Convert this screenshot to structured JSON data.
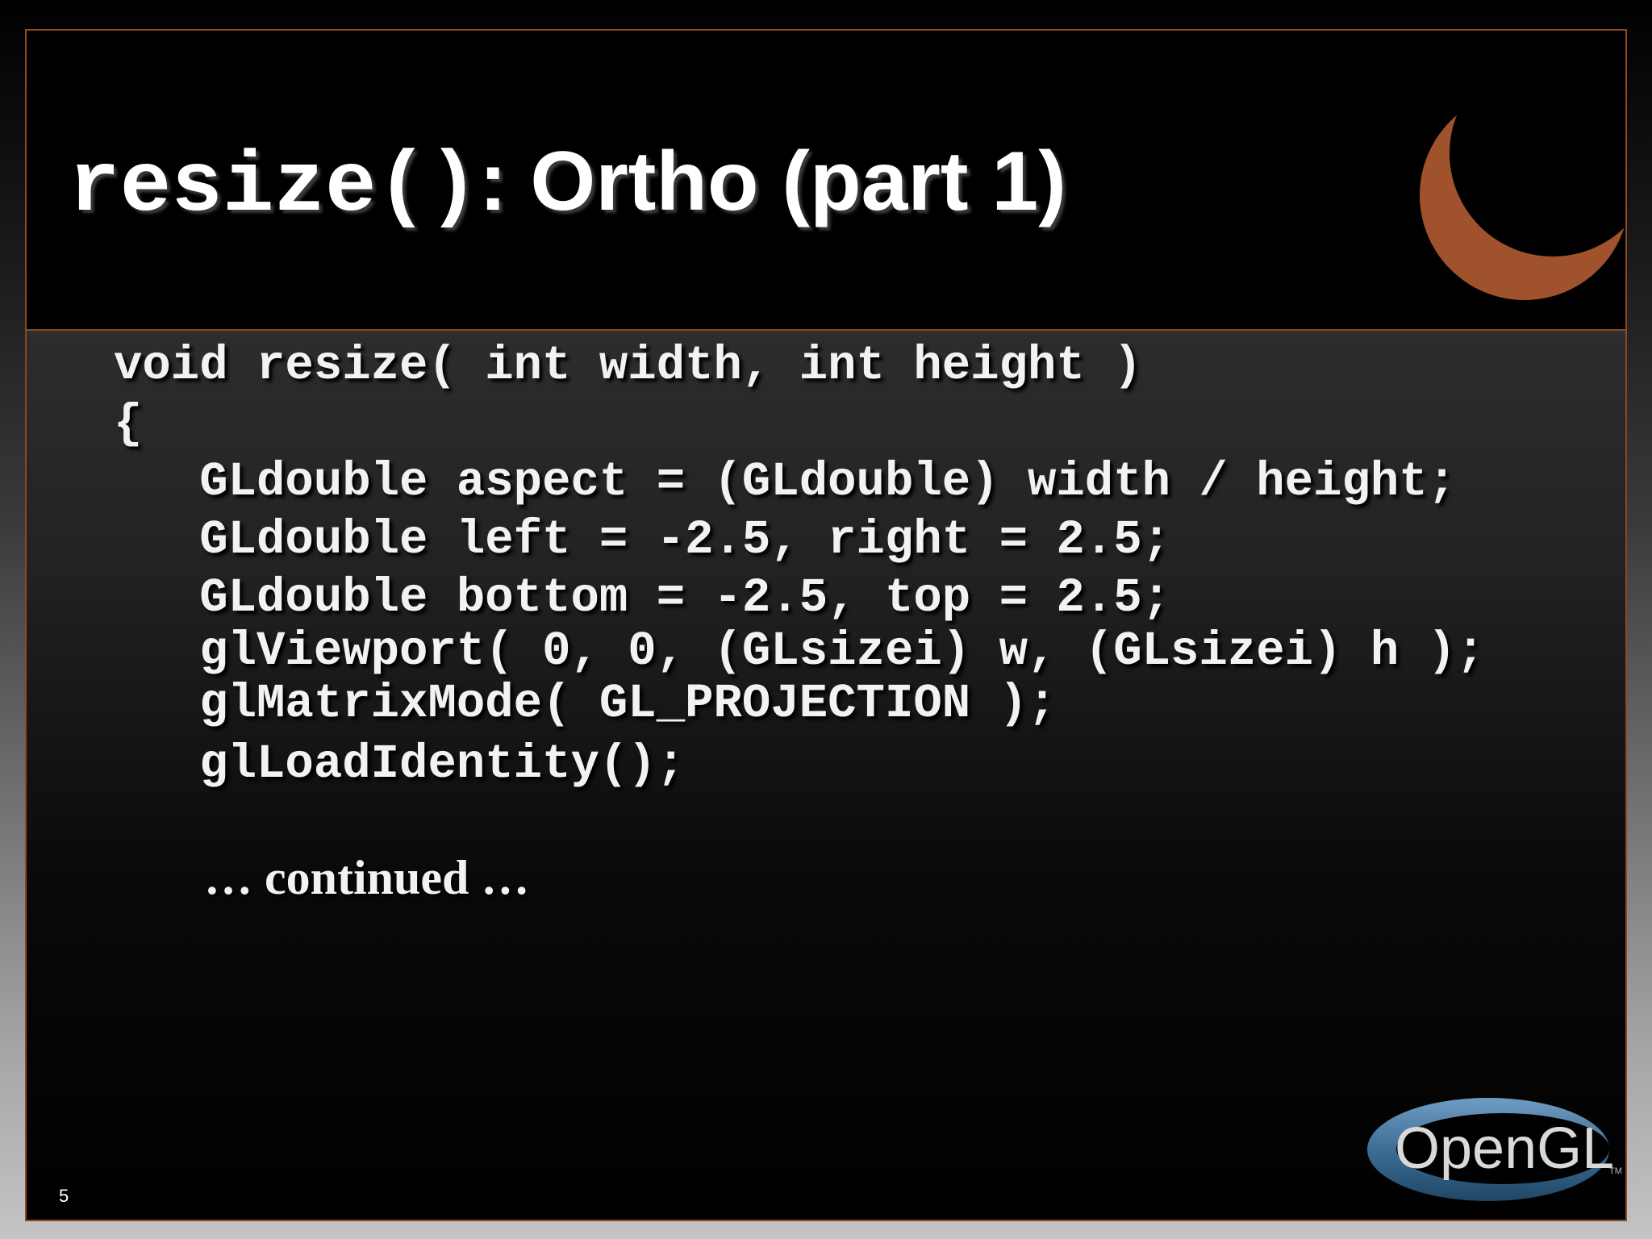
{
  "slide": {
    "title_code": "resize()",
    "title_text": ": Ortho (part 1)",
    "code_lines": [
      "void resize( int width, int height )",
      "{",
      "   GLdouble aspect = (GLdouble) width / height;",
      "   GLdouble left = -2.5, right = 2.5;",
      "   GLdouble bottom = -2.5, top = 2.5;",
      "   glViewport( 0, 0, (GLsizei) w, (GLsizei) h );",
      "   glMatrixMode( GL_PROJECTION );",
      "   glLoadIdentity();"
    ],
    "continued": "… continued …",
    "page_number": "5"
  },
  "logo": {
    "text": "OpenGL",
    "tm": "TM"
  },
  "colors": {
    "border": "#8a4a22",
    "moon": "#a0522d",
    "logo_ring": "#3d6e96",
    "text": "#ffffff"
  },
  "icons": {
    "corner_graphic": "crescent-moon-icon",
    "logo": "opengl-logo"
  }
}
